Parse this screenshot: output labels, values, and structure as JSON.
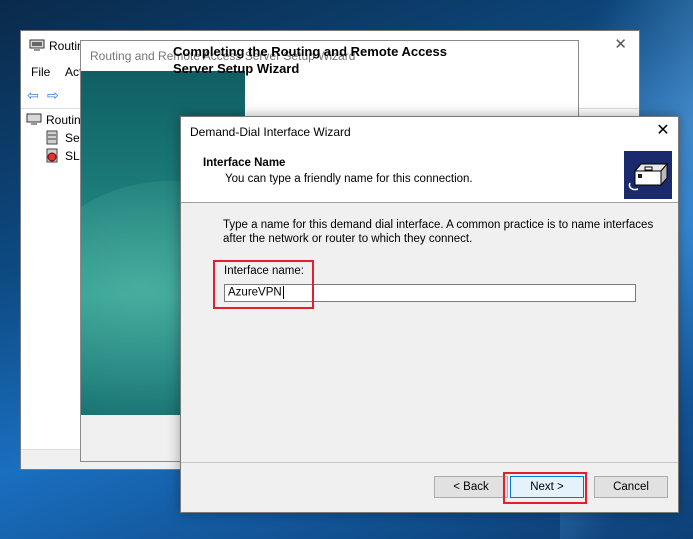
{
  "mmc": {
    "title": "Routing",
    "menu": [
      "File",
      "Act"
    ],
    "tree": [
      "Routin",
      "Ser",
      "SL-"
    ]
  },
  "setup_wizard": {
    "title": "Routing and Remote Access Server Setup Wizard",
    "heading": "Completing the Routing and Remote Access Server Setup Wizard"
  },
  "ddi_wizard": {
    "title": "Demand-Dial Interface Wizard",
    "header_title": "Interface Name",
    "header_subtitle": "You can type a friendly name for this connection.",
    "instruction": "Type a name for this demand dial interface.  A common practice is to name interfaces after the network or router to which they connect.",
    "field_label": "Interface name:",
    "field_value": "AzureVPN",
    "buttons": {
      "back": "< Back",
      "next": "Next >",
      "cancel": "Cancel"
    }
  },
  "icons": {
    "close": "close-icon",
    "back_arrow": "back-arrow-icon",
    "forward_arrow": "forward-arrow-icon",
    "wizard": "network-connection-icon"
  },
  "colors": {
    "highlight": "#e0202a",
    "accent": "#0078d7",
    "wizard_side": "#1b7c78"
  }
}
